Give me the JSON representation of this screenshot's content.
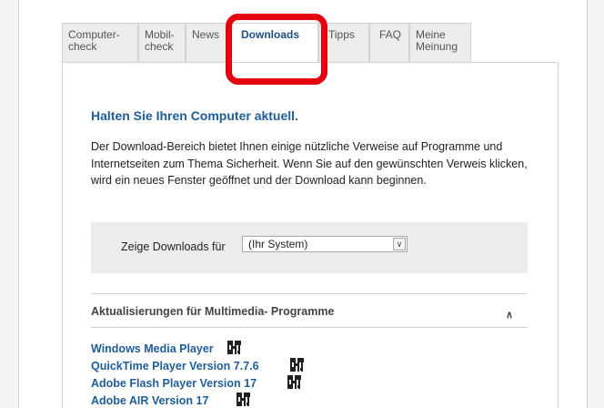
{
  "tabs": [
    {
      "label": "Computer-\ncheck"
    },
    {
      "label": "Mobil-\ncheck"
    },
    {
      "label": "News"
    },
    {
      "label": "Downloads"
    },
    {
      "label": "Tipps"
    },
    {
      "label": "FAQ"
    },
    {
      "label": "Meine\nMeinung"
    }
  ],
  "main": {
    "heading": "Halten Sie Ihren Computer aktuell.",
    "intro": "Der Download-Bereich bietet Ihnen einige nützliche Verweise auf Programme und Internetseiten zum Thema Sicherheit. Wenn Sie auf den gewünschten Verweis klicken, wird ein neues Fenster geöffnet und der Download kann beginnen."
  },
  "filter": {
    "label": "Zeige Downloads für",
    "selected": "(Ihr System)"
  },
  "section": {
    "title": "Aktualisierungen für Multimedia- Programme"
  },
  "downloads": [
    {
      "label": "Windows Media Player"
    },
    {
      "label": "QuickTime Player Version 7.7.6"
    },
    {
      "label": "Adobe Flash Player Version 17"
    },
    {
      "label": "Adobe AIR Version 17"
    }
  ],
  "colors": {
    "accent": "#1f5d99",
    "highlight": "#e4000f"
  }
}
